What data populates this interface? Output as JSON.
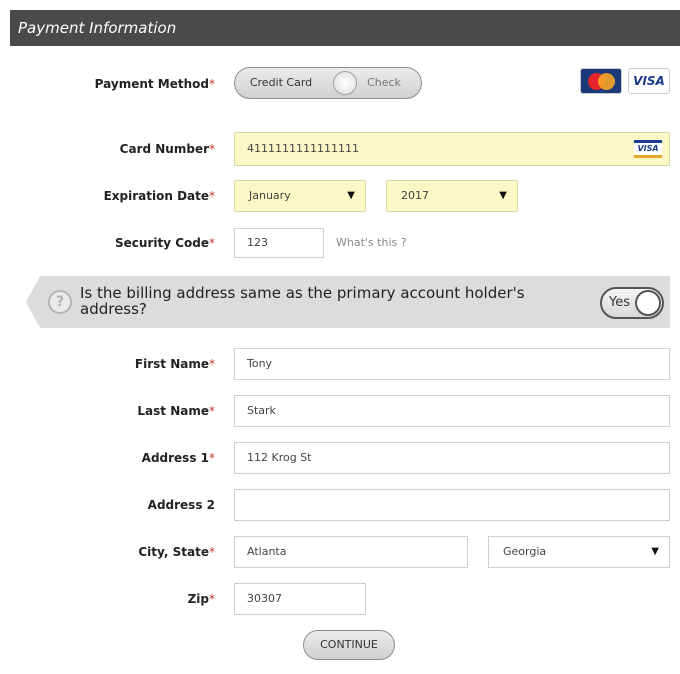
{
  "header": {
    "title": "Payment Information"
  },
  "payment_method": {
    "label": "Payment Method",
    "options": [
      "Credit Card",
      "Check"
    ],
    "selected": "Credit Card",
    "logos": [
      "mastercard-logo",
      "visa-logo"
    ]
  },
  "required_marker": "*",
  "card_number": {
    "label": "Card Number",
    "value": "4111111111111111",
    "card_icon": "visa-logo"
  },
  "expiration": {
    "label": "Expiration Date",
    "month": "January",
    "year": "2017"
  },
  "security_code": {
    "label": "Security Code",
    "value": "123",
    "hint": "What's this ?"
  },
  "billing": {
    "question": "Is the billing address same as the primary account holder's address?",
    "help_icon": "?",
    "toggle_label": "Yes"
  },
  "first_name": {
    "label": "First Name",
    "value": "Tony"
  },
  "last_name": {
    "label": "Last Name",
    "value": "Stark"
  },
  "address1": {
    "label": "Address 1",
    "value": "112 Krog St"
  },
  "address2": {
    "label": "Address 2",
    "value": ""
  },
  "city_state": {
    "label": "City, State",
    "city": "Atlanta",
    "state": "Georgia"
  },
  "zip": {
    "label": "Zip",
    "value": "30307"
  },
  "continue_label": "CONTINUE",
  "colors": {
    "header_bg": "#4a4a4a",
    "highlight_field": "#fbf8c5",
    "required": "#c0392b"
  }
}
